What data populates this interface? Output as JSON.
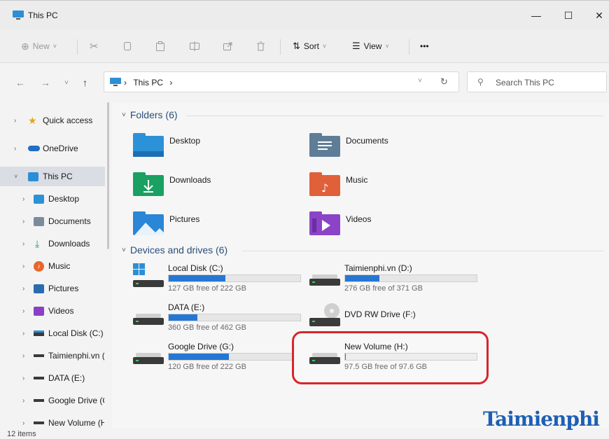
{
  "window": {
    "title": "This PC"
  },
  "window_controls": {
    "minimize": "—",
    "maximize": "☐",
    "close": "✕"
  },
  "toolbar": {
    "new_label": "New",
    "sort_label": "Sort",
    "view_label": "View",
    "more_label": "•••"
  },
  "navigation": {
    "breadcrumb": [
      "This PC"
    ],
    "search_placeholder": "Search This PC"
  },
  "sidebar": {
    "items": [
      {
        "label": "Quick access",
        "icon": "star-icon",
        "color": "#e5a51a"
      },
      {
        "label": "OneDrive",
        "icon": "cloud-icon",
        "color": "#1f6fc4"
      },
      {
        "label": "This PC",
        "icon": "computer-icon",
        "color": "#2c8fd6"
      },
      {
        "label": "Desktop",
        "icon": "desktop-folder-icon",
        "color": "#2c92d8"
      },
      {
        "label": "Documents",
        "icon": "documents-folder-icon",
        "color": "#7a8b9c"
      },
      {
        "label": "Downloads",
        "icon": "download-arrow-icon",
        "color": "#17a34a"
      },
      {
        "label": "Music",
        "icon": "music-icon",
        "color": "#e8662b"
      },
      {
        "label": "Pictures",
        "icon": "pictures-icon",
        "color": "#2b6cb0"
      },
      {
        "label": "Videos",
        "icon": "videos-icon",
        "color": "#8a3fc6"
      },
      {
        "label": "Local Disk (C:)",
        "icon": "windows-drive-icon",
        "color": "#3a3a3a"
      },
      {
        "label": "Taimienphi.vn (",
        "icon": "drive-icon",
        "color": "#3a3a3a"
      },
      {
        "label": "DATA (E:)",
        "icon": "drive-icon",
        "color": "#3a3a3a"
      },
      {
        "label": "Google Drive (C",
        "icon": "drive-icon",
        "color": "#3a3a3a"
      },
      {
        "label": "New Volume (H",
        "icon": "drive-icon",
        "color": "#3a3a3a"
      }
    ]
  },
  "main": {
    "folders_header": "Folders (6)",
    "folders": [
      {
        "name": "Desktop",
        "icon": "desktop-folder-icon",
        "color": "#2c92d8"
      },
      {
        "name": "Documents",
        "icon": "documents-folder-icon",
        "color": "#5f7d96"
      },
      {
        "name": "Downloads",
        "icon": "downloads-folder-icon",
        "color": "#1aa062"
      },
      {
        "name": "Music",
        "icon": "music-folder-icon",
        "color": "#e0603a"
      },
      {
        "name": "Pictures",
        "icon": "pictures-folder-icon",
        "color": "#2a86d6"
      },
      {
        "name": "Videos",
        "icon": "videos-folder-icon",
        "color": "#8b44c8"
      }
    ],
    "drives_header": "Devices and drives (6)",
    "drives": [
      {
        "name": "Local Disk (C:)",
        "free": "127 GB free of 222 GB",
        "used_fraction": 0.43,
        "icon": "windows-drive-icon"
      },
      {
        "name": "Taimienphi.vn (D:)",
        "free": "276 GB free of 371 GB",
        "used_fraction": 0.26,
        "icon": "drive-icon"
      },
      {
        "name": "DATA (E:)",
        "free": "360 GB free of 462 GB",
        "used_fraction": 0.22,
        "icon": "drive-icon"
      },
      {
        "name": "DVD RW Drive (F:)",
        "free": "",
        "used_fraction": null,
        "icon": "dvd-drive-icon"
      },
      {
        "name": "Google Drive (G:)",
        "free": "120 GB free of 222 GB",
        "used_fraction": 0.46,
        "icon": "drive-icon"
      },
      {
        "name": "New Volume (H:)",
        "free": "97.5 GB free of 97.6 GB",
        "used_fraction": 0.001,
        "icon": "drive-icon"
      }
    ]
  },
  "status": {
    "items_count": "12 items"
  },
  "watermark": {
    "text": "Taimienphi"
  },
  "colors": {
    "accent": "#2677d4",
    "highlight": "#d8262a",
    "header_text": "#2a4f7a"
  }
}
